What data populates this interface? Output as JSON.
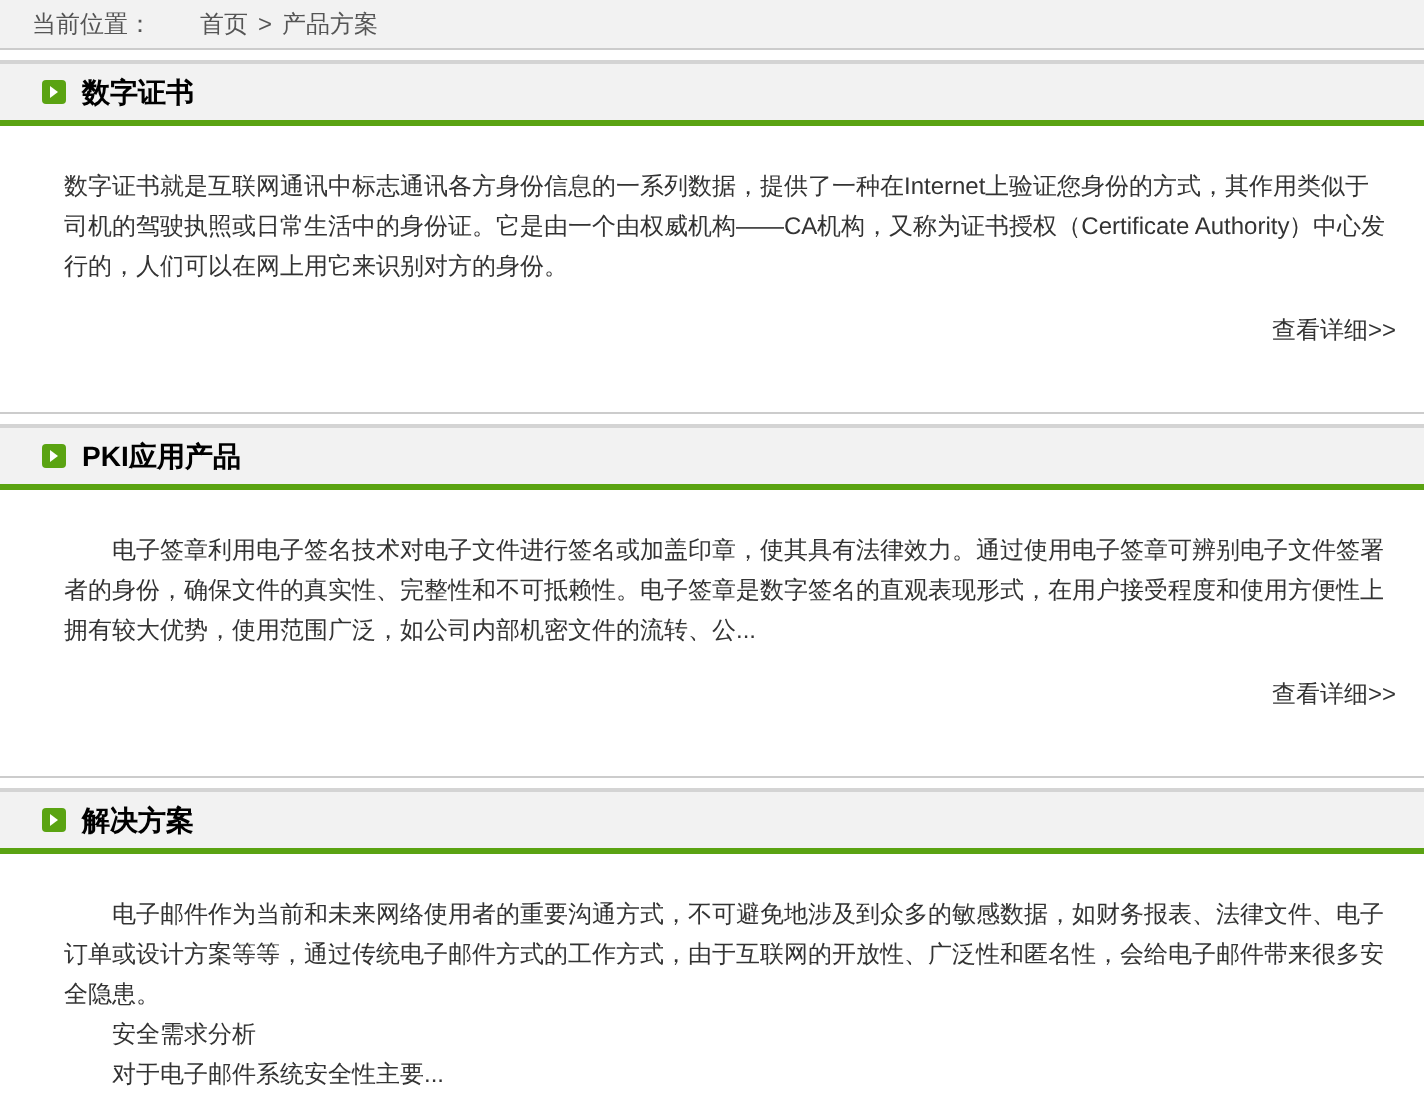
{
  "breadcrumb": {
    "label": "当前位置：",
    "items": [
      "首页",
      "产品方案"
    ],
    "separator": ">"
  },
  "sections": [
    {
      "title": "数字证书",
      "paragraphs": [
        {
          "text": "数字证书就是互联网通讯中标志通讯各方身份信息的一系列数据，提供了一种在Internet上验证您身份的方式，其作用类似于司机的驾驶执照或日常生活中的身份证。它是由一个由权威机构——CA机构，又称为证书授权（Certificate Authority）中心发行的，人们可以在网上用它来识别对方的身份。",
          "indent": false
        }
      ],
      "more": "查看详细>>"
    },
    {
      "title": "PKI应用产品",
      "paragraphs": [
        {
          "text": "电子签章利用电子签名技术对电子文件进行签名或加盖印章，使其具有法律效力。通过使用电子签章可辨别电子文件签署者的身份，确保文件的真实性、完整性和不可抵赖性。电子签章是数字签名的直观表现形式，在用户接受程度和使用方便性上拥有较大优势，使用范围广泛，如公司内部机密文件的流转、公...",
          "indent": true
        }
      ],
      "more": "查看详细>>"
    },
    {
      "title": "解决方案",
      "paragraphs": [
        {
          "text": "电子邮件作为当前和未来网络使用者的重要沟通方式，不可避免地涉及到众多的敏感数据，如财务报表、法律文件、电子订单或设计方案等等，通过传统电子邮件方式的工作方式，由于互联网的开放性、广泛性和匿名性，会给电子邮件带来很多安全隐患。",
          "indent": true
        },
        {
          "text": "安全需求分析",
          "indent": true
        },
        {
          "text": "对于电子邮件系统安全性主要...",
          "indent": true
        }
      ]
    }
  ]
}
